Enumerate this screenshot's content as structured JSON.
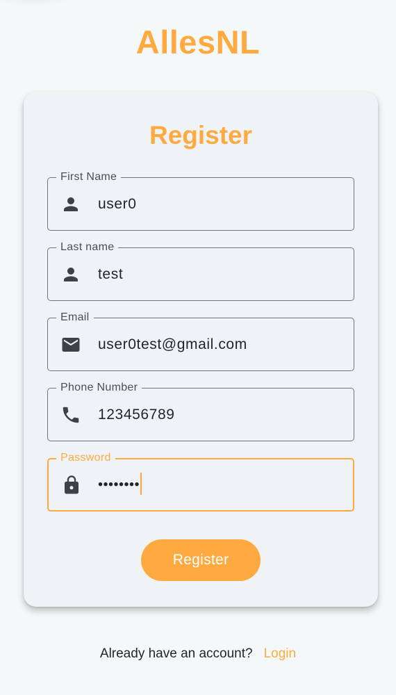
{
  "app": {
    "title": "AllesNL"
  },
  "form": {
    "title": "Register",
    "fields": [
      {
        "label": "First Name",
        "value": "user0",
        "icon": "person-icon"
      },
      {
        "label": "Last name",
        "value": "test",
        "icon": "person-icon"
      },
      {
        "label": "Email",
        "value": "user0test@gmail.com",
        "icon": "email-icon"
      },
      {
        "label": "Phone Number",
        "value": "123456789",
        "icon": "phone-icon"
      },
      {
        "label": "Password",
        "value": "••••••••",
        "icon": "lock-icon",
        "focused": true
      }
    ],
    "submit_label": "Register"
  },
  "footer": {
    "prompt": "Already have an account?",
    "login_label": "Login"
  },
  "colors": {
    "accent": "#ffaa40",
    "background": "#f4f8f9",
    "card": "#eff3f6",
    "icon": "#3c4247"
  }
}
